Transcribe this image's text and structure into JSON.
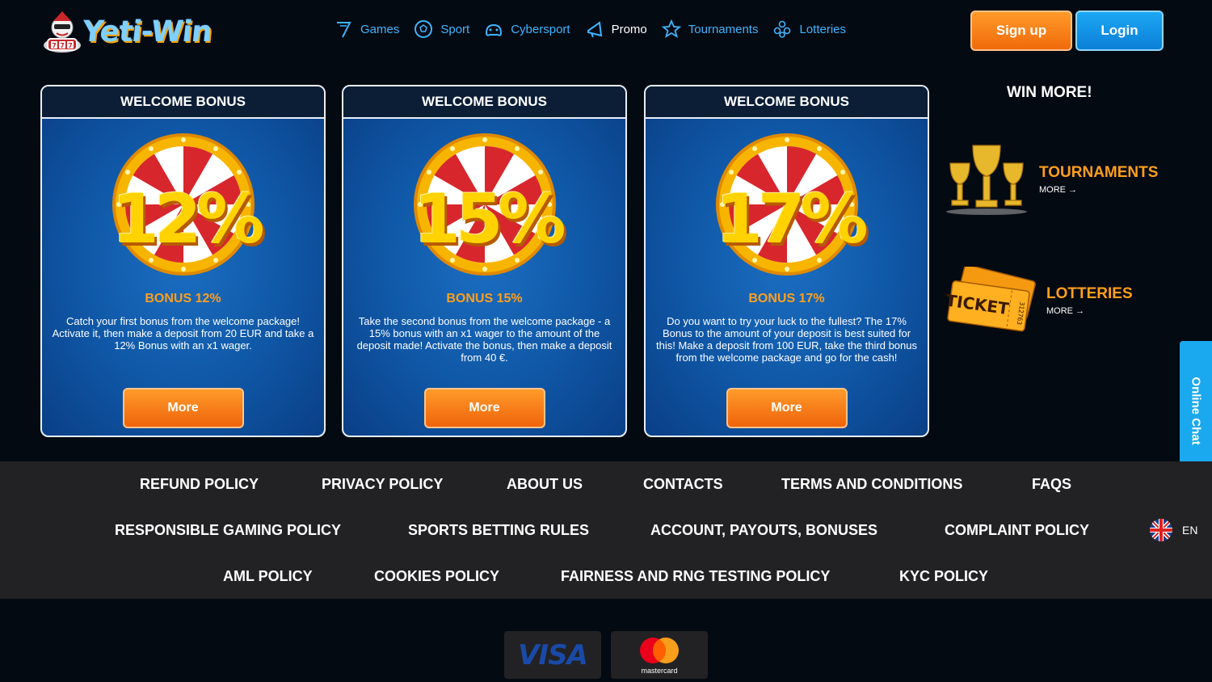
{
  "header": {
    "logo_text": "Yeti-Win",
    "nav": [
      {
        "label": "Games",
        "icon": "seven-icon"
      },
      {
        "label": "Sport",
        "icon": "soccer-ball-icon"
      },
      {
        "label": "Cybersport",
        "icon": "gamepad-icon"
      },
      {
        "label": "Promo",
        "icon": "megaphone-icon"
      },
      {
        "label": "Tournaments",
        "icon": "star-icon"
      },
      {
        "label": "Lotteries",
        "icon": "lottery-balls-icon"
      }
    ],
    "signup_label": "Sign up",
    "login_label": "Login"
  },
  "bonuses": [
    {
      "header": "WELCOME BONUS",
      "percent": "12%",
      "title": "BONUS 12%",
      "desc": "Catch your first bonus from the welcome package! Activate it, then make a deposit from 20 EUR and take a 12% Bonus with an x1 wager.",
      "button": "More"
    },
    {
      "header": "WELCOME BONUS",
      "percent": "15%",
      "title": "BONUS 15%",
      "desc": "Take the second bonus from the welcome package - a 15% bonus with an x1 wager to the amount of the deposit made! Activate the bonus, then make a deposit from 40 €.",
      "button": "More"
    },
    {
      "header": "WELCOME BONUS",
      "percent": "17%",
      "title": "BONUS 17%",
      "desc": "Do you want to try your luck to the fullest? The 17% Bonus to the amount of your deposit is best suited for this! Make a deposit from 100 EUR, take the third bonus from the welcome package and go for the cash!",
      "button": "More"
    }
  ],
  "win_more": {
    "title": "WIN MORE!",
    "items": [
      {
        "label": "TOURNAMENTS",
        "more": "MORE",
        "icon": "trophy-icon"
      },
      {
        "label": "LOTTERIES",
        "more": "MORE",
        "icon": "ticket-icon",
        "ticket_text": "TICKET",
        "ticket_number": "312763"
      }
    ]
  },
  "chat_label": "Online Chat",
  "footer": {
    "links_row1": [
      "REFUND POLICY",
      "PRIVACY POLICY",
      "ABOUT US",
      "CONTACTS",
      "TERMS AND CONDITIONS",
      "FAQS"
    ],
    "links_row2": [
      "RESPONSIBLE GAMING POLICY",
      "SPORTS BETTING RULES",
      "ACCOUNT, PAYOUTS, BONUSES",
      "COMPLAINT POLICY"
    ],
    "links_row3": [
      "AML POLICY",
      "COOKIES POLICY",
      "FAIRNESS AND RNG TESTING POLICY",
      "KYC POLICY"
    ],
    "language": "EN"
  },
  "payments": {
    "visa": "VISA",
    "mastercard": "mastercard"
  },
  "colors": {
    "accent_orange": "#ff9f1c",
    "accent_blue": "#1aa9ef",
    "background": "#040a12"
  }
}
